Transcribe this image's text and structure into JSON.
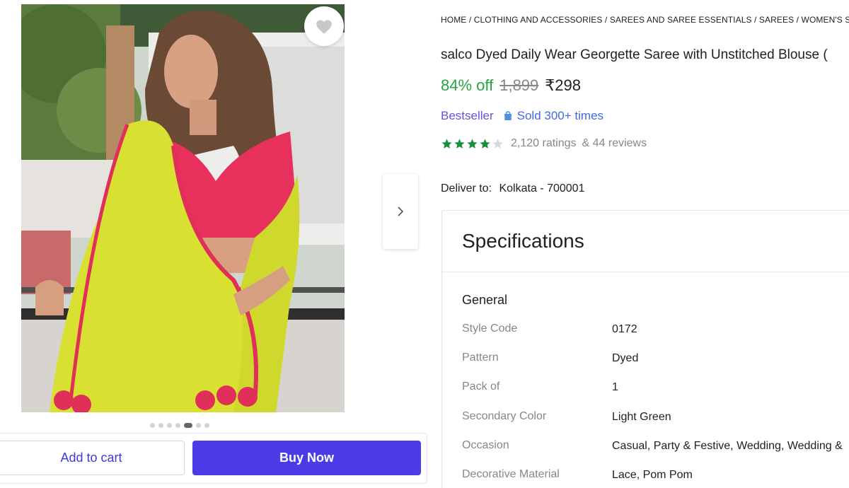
{
  "breadcrumb": [
    "HOME",
    "CLOTHING AND ACCESSORIES",
    "SAREES AND SAREE ESSENTIALS",
    "SAREES",
    "WOMEN'S SARE"
  ],
  "product": {
    "title": "salco Dyed Daily Wear Georgette Saree with Unstitched Blouse (",
    "discount": "84% off",
    "mrp": "1,899",
    "price": "₹298",
    "bestseller": "Bestseller",
    "sold": "Sold 300+ times",
    "rating_value": 4,
    "rating_max": 5,
    "ratings_text": "2,120 ratings",
    "reviews_text": "& 44 reviews"
  },
  "delivery": {
    "label": "Deliver to:",
    "location": "Kolkata - 700001"
  },
  "gallery": {
    "image_count": 7,
    "active_index": 4
  },
  "actions": {
    "add_to_cart": "Add to cart",
    "buy_now": "Buy Now"
  },
  "specifications": {
    "title": "Specifications",
    "group": "General",
    "rows": [
      {
        "key": "Style Code",
        "value": "0172"
      },
      {
        "key": "Pattern",
        "value": "Dyed"
      },
      {
        "key": "Pack of",
        "value": "1"
      },
      {
        "key": "Secondary Color",
        "value": "Light Green"
      },
      {
        "key": "Occasion",
        "value": "Casual, Party & Festive, Wedding, Wedding &"
      },
      {
        "key": "Decorative Material",
        "value": "Lace, Pom Pom"
      }
    ]
  },
  "colors": {
    "discount": "#26a541",
    "buy_button": "#4b3ce8",
    "star": "#1a8f3a",
    "link": "#4169e1"
  },
  "icons": {
    "wishlist": "heart-icon",
    "next": "chevron-right-icon",
    "sold": "shopping-bag-icon",
    "rating": "star-icon"
  }
}
